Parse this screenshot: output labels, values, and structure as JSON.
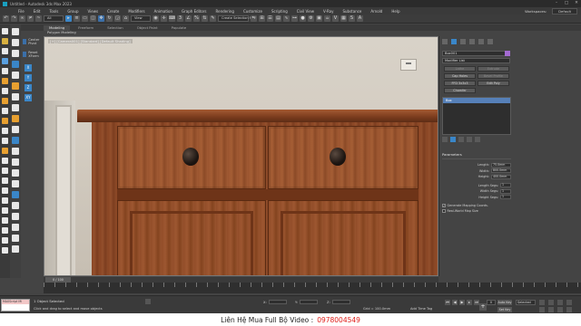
{
  "window": {
    "title": "Untitled - Autodesk 3ds Max 2023",
    "controls": [
      "–",
      "□",
      "✕"
    ]
  },
  "menu": {
    "items": [
      "File",
      "Edit",
      "Tools",
      "Group",
      "Views",
      "Create",
      "Modifiers",
      "Animation",
      "Graph Editors",
      "Rendering",
      "Customize",
      "Scripting",
      "Civil View",
      "V-Ray",
      "Substance",
      "Arnold",
      "Help"
    ],
    "workspaces_label": "Workspaces:",
    "workspace_value": "Default"
  },
  "toolbar": {
    "filter_value": "All",
    "view_value": "View",
    "selection_set_value": "Create Selection Se"
  },
  "ribbon": {
    "tabs": [
      "Modeling",
      "Freeform",
      "Selection",
      "Object Paint",
      "Populate"
    ],
    "sub_label": "Polygon Modeling"
  },
  "left_panel": {
    "center_pivot": "Center Pivot",
    "reset_xform": "Reset XForm",
    "axes": [
      "X",
      "Y",
      "Z",
      "XY"
    ]
  },
  "viewport": {
    "label": "[+] [Camera001] [Standard] [Default Shading]"
  },
  "command_panel": {
    "object_name": "Box001",
    "object_color": "#a36bd1",
    "modifier_list": "Modifier List",
    "buttons": [
      "Lathe",
      "Extrude",
      "Cap Holes",
      "Bevel Profile",
      "FFD 3x3x3",
      "Edit Poly",
      "Chamfer"
    ],
    "disabled_buttons": [
      "Lathe",
      "Extrude",
      "Bevel Profile"
    ],
    "stack_item": "Box",
    "parameters": {
      "header": "Parameters",
      "length_label": "Length:",
      "length_value": "75.0mm",
      "width_label": "Width:",
      "width_value": "800.0mm",
      "height_label": "Height:",
      "height_value": "400.0mm",
      "length_segs_label": "Length Segs:",
      "length_segs_value": "1",
      "width_segs_label": "Width Segs:",
      "width_segs_value": "1",
      "height_segs_label": "Height Segs:",
      "height_segs_value": "1",
      "gen_mapping_label": "Generate Mapping Coords.",
      "gen_mapping_checked": true,
      "real_world_label": "Real-World Map Size",
      "real_world_checked": false
    }
  },
  "timeline": {
    "slider_text": "0 / 100"
  },
  "status": {
    "maxscript_text": "MAXScript Mi",
    "objects_selected": "1 Object Selected",
    "hint": "Click and drag to select and move objects",
    "x_label": "X:",
    "y_label": "Y:",
    "z_label": "Z:",
    "grid": "Grid = 100.0mm",
    "add_time_tag": "Add Time Tag",
    "auto_key": "Auto Key",
    "set_key": "Set Key",
    "frame": "0",
    "selected": "Selected"
  },
  "banner": {
    "text": "Liên Hệ Mua Full Bộ Video :",
    "phone": "0978004549",
    "phone_color": "#e0201b"
  }
}
